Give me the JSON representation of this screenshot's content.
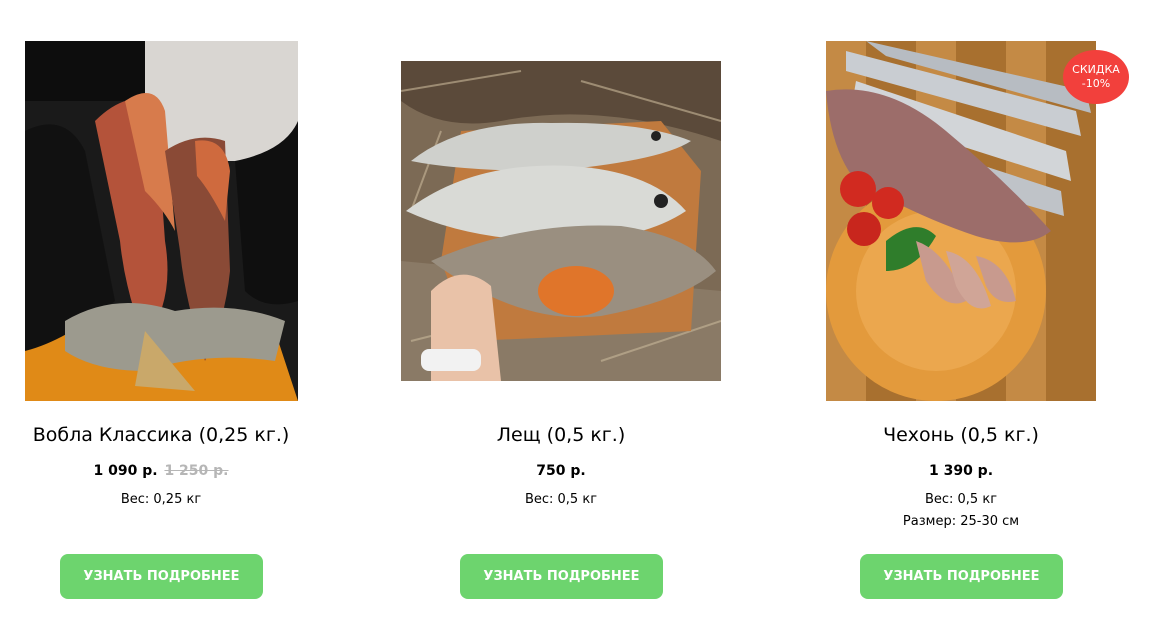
{
  "products": [
    {
      "title": "Вобла Классика (0,25 кг.)",
      "price": "1 090 р.",
      "old_price": "1 250 р.",
      "weight": "Вес: 0,25 кг",
      "button": "УЗНАТЬ ПОДРОБНЕЕ"
    },
    {
      "title": "Лещ (0,5 кг.)",
      "price": "750 р.",
      "weight": "Вес: 0,5 кг",
      "button": "УЗНАТЬ ПОДРОБНЕЕ"
    },
    {
      "title": "Чехонь (0,5 кг.)",
      "price": "1 390 р.",
      "weight": "Вес: 0,5 кг",
      "size": "Размер: 25-30 см",
      "button": "УЗНАТЬ ПОДРОБНЕЕ",
      "badge": {
        "line1": "СКИДКА",
        "line2": "-10%"
      }
    }
  ],
  "colors": {
    "button_bg": "#6dd46e",
    "badge_bg": "#f2403c",
    "old_price": "#b6b6b6"
  }
}
